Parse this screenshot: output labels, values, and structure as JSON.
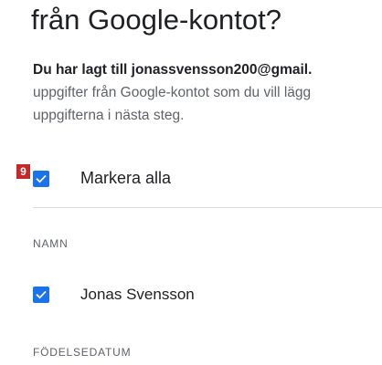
{
  "heading": {
    "title": "från Google-kontot?"
  },
  "description": {
    "bold_line": "Du har lagt till jonassvensson200@gmail.",
    "line2": "uppgifter från Google-kontot som du vill lägg",
    "line3": "uppgifterna i nästa steg."
  },
  "annotation": {
    "badge": "9"
  },
  "select_all": {
    "label": "Markera alla",
    "checked": true,
    "icon": "check-icon"
  },
  "sections": {
    "name": {
      "label": "NAMN",
      "item_label": "Jonas Svensson",
      "checked": true,
      "icon": "check-icon"
    },
    "birth": {
      "label": "FÖDELSEDATUM"
    }
  },
  "colors": {
    "accent": "#1a73e8",
    "badge": "#c62828",
    "text_primary": "#202124",
    "text_secondary": "#5f6368",
    "divider": "#dadce0"
  }
}
